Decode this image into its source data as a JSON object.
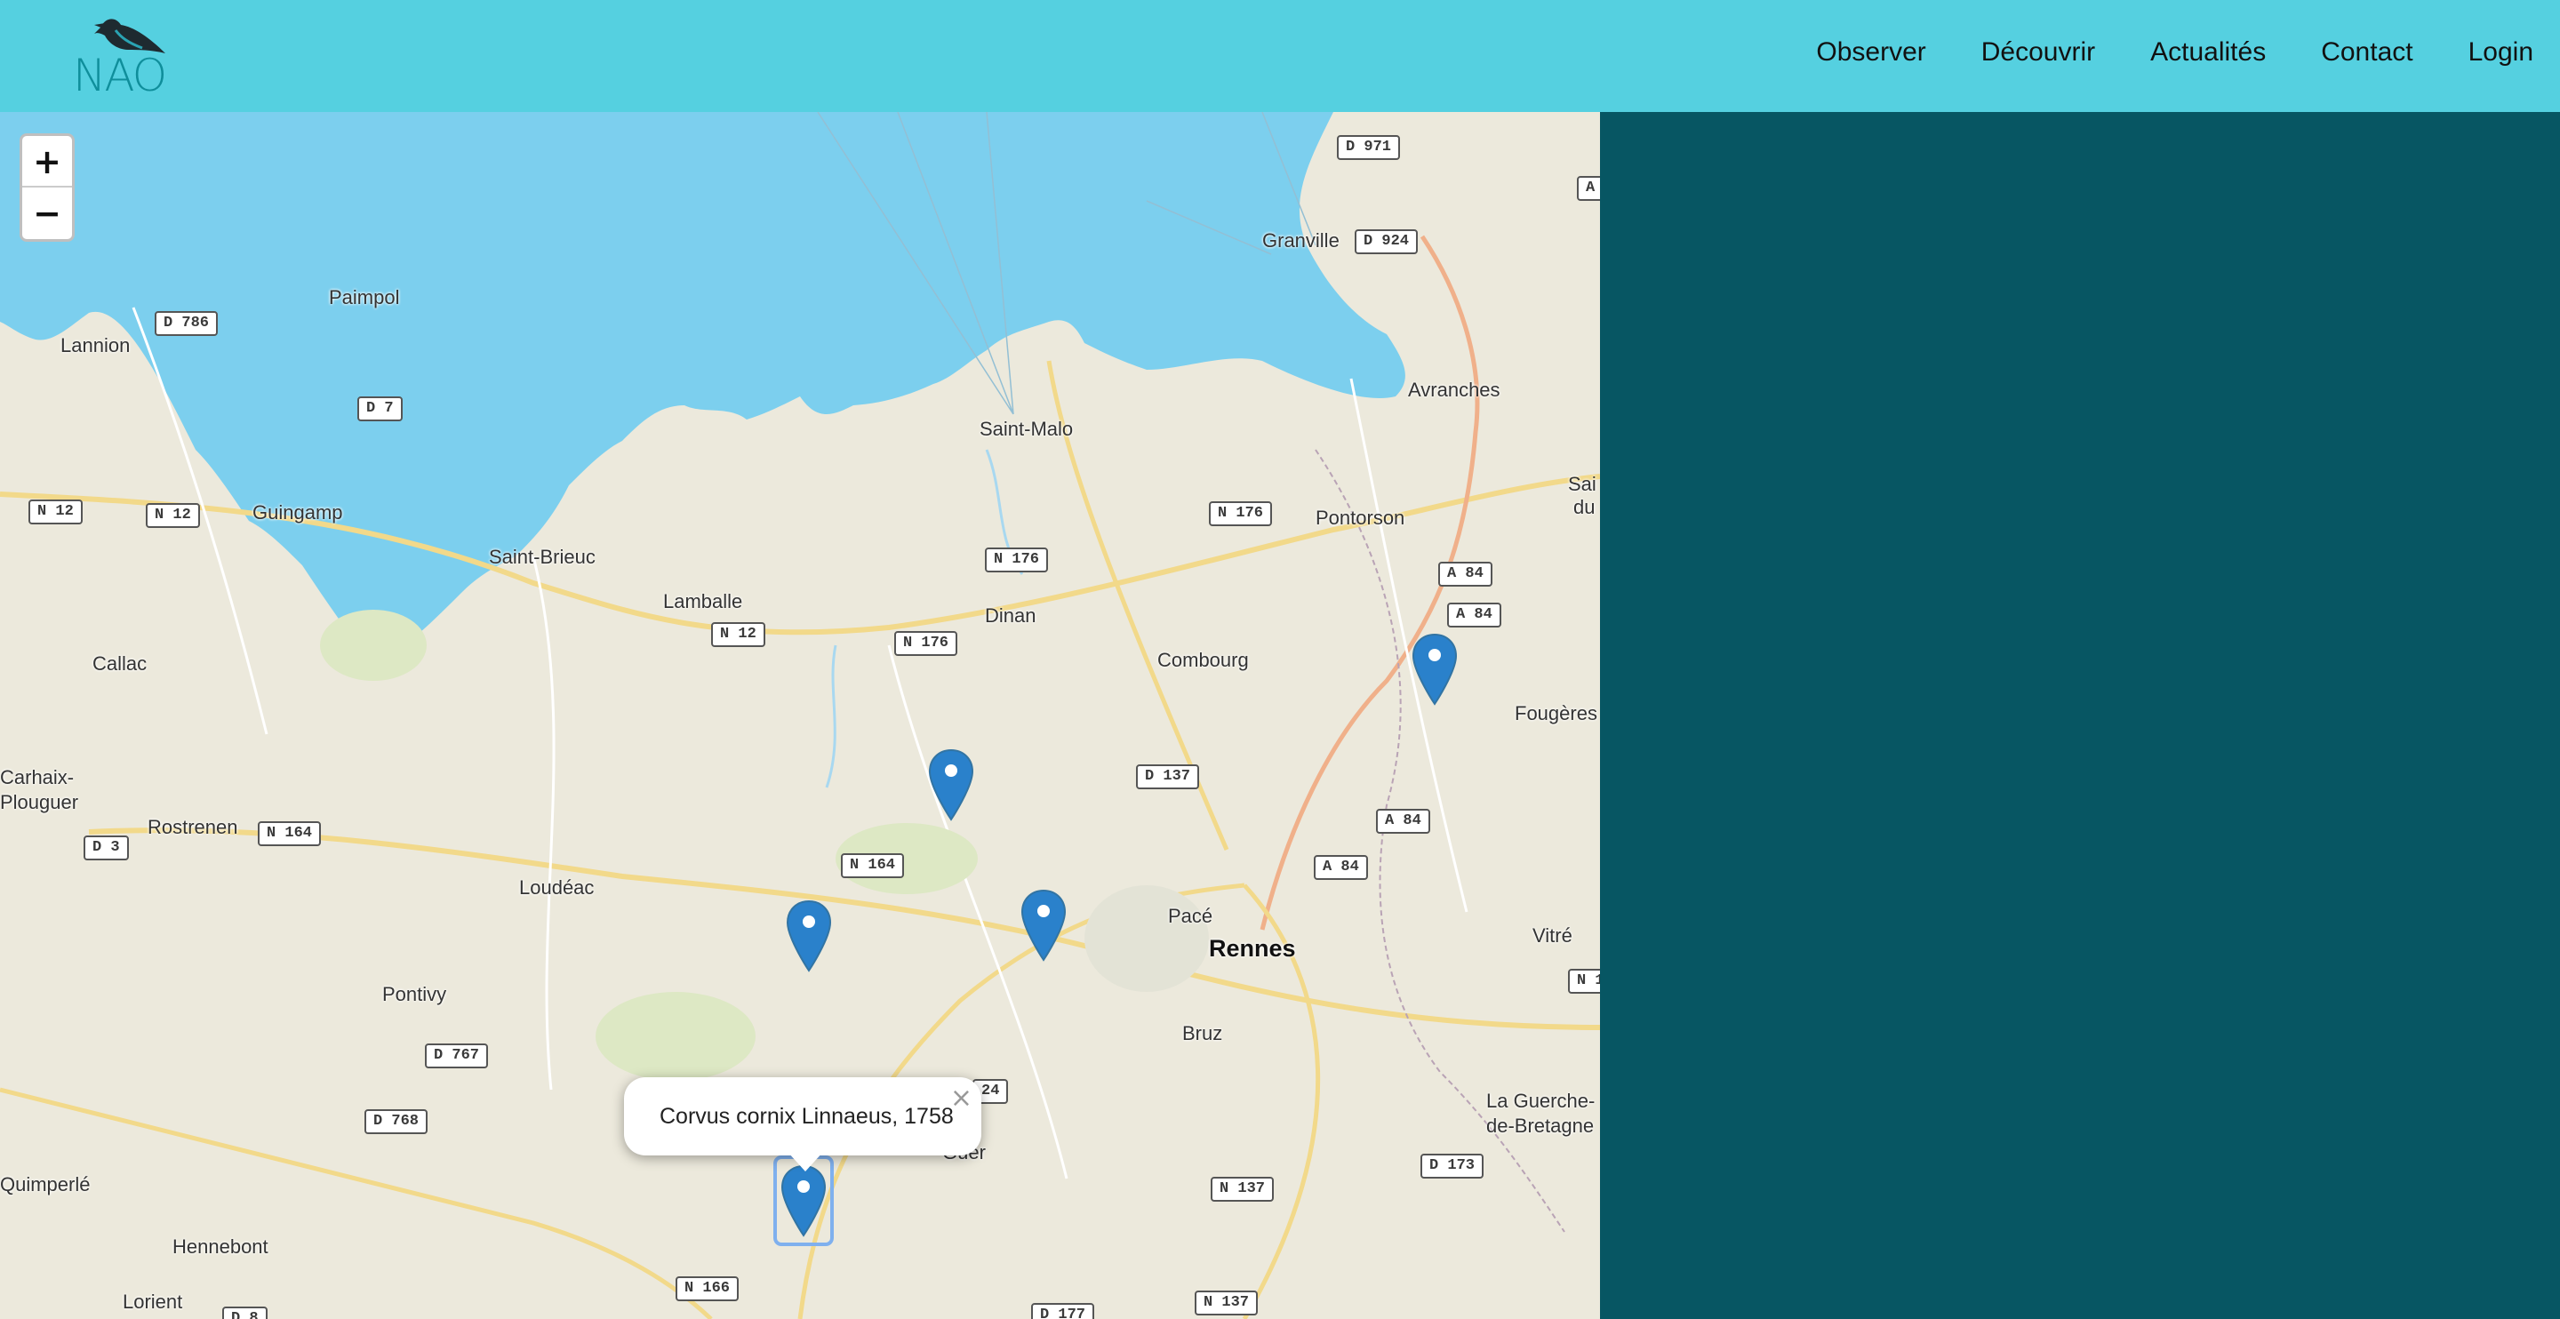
{
  "brand": {
    "logo_text": "NAO",
    "colors": {
      "header": "#55d0e0",
      "panel": "#075663",
      "sea": "#7ccfee",
      "land": "#ece9dc",
      "marker": "#2a81cb"
    }
  },
  "nav": {
    "items": [
      "Observer",
      "Découvrir",
      "Actualités",
      "Contact",
      "Login"
    ]
  },
  "map": {
    "zoom_in": "+",
    "zoom_out": "−",
    "places": [
      "Granville",
      "Paimpol",
      "Lannion",
      "Avranches",
      "Saint-Malo",
      "Pontorson",
      "Guingamp",
      "Saint-Brieuc",
      "Lamballe",
      "Dinan",
      "Callac",
      "Combourg",
      "Fougères",
      "Carhaix-",
      "Plouguer",
      "Rostrenen",
      "Loudéac",
      "Pacé",
      "Rennes",
      "Vitré",
      "Pontivy",
      "Bruz",
      "La Guerche-",
      "de-Bretagne",
      "Quimperlé",
      "Hennebont",
      "Lorient",
      "Sai",
      "du",
      "Guer"
    ],
    "roads": [
      "D 971",
      "D 924",
      "D 786",
      "D 7",
      "N 12",
      "N 12",
      "N 176",
      "N 176",
      "N 12",
      "N 176",
      "A 84",
      "A 84",
      "D 137",
      "A 84",
      "A 84",
      "D 3",
      "N 164",
      "N 164",
      "D 767",
      "D 768",
      "24",
      "N 137",
      "D 173",
      "N 166",
      "D 177",
      "N 137",
      "N 1",
      "A",
      "D 8"
    ],
    "marker_icon": "map-pin-icon",
    "popup": {
      "text": "Corvus cornix Linnaeus, 1758",
      "close": "×"
    }
  }
}
